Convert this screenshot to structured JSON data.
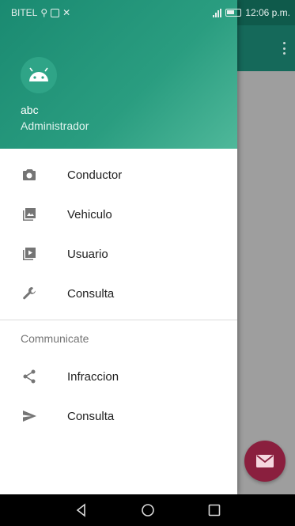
{
  "status_bar": {
    "carrier": "BITEL",
    "time": "12:06 p.m."
  },
  "drawer": {
    "header": {
      "user_name": "abc",
      "user_role": "Administrador",
      "avatar_icon": "android-icon"
    },
    "items": [
      {
        "label": "Conductor",
        "icon": "camera-icon"
      },
      {
        "label": "Vehiculo",
        "icon": "gallery-icon"
      },
      {
        "label": "Usuario",
        "icon": "slideshow-icon"
      },
      {
        "label": "Consulta",
        "icon": "wrench-icon"
      }
    ],
    "section_title": "Communicate",
    "section_items": [
      {
        "label": "Infraccion",
        "icon": "share-icon"
      },
      {
        "label": "Consulta",
        "icon": "send-icon"
      }
    ]
  },
  "colors": {
    "primary": "#15695a",
    "primary_dark": "#0f5a4b",
    "accent": "#8a1f3e",
    "header_gradient": "#2a9d80"
  }
}
